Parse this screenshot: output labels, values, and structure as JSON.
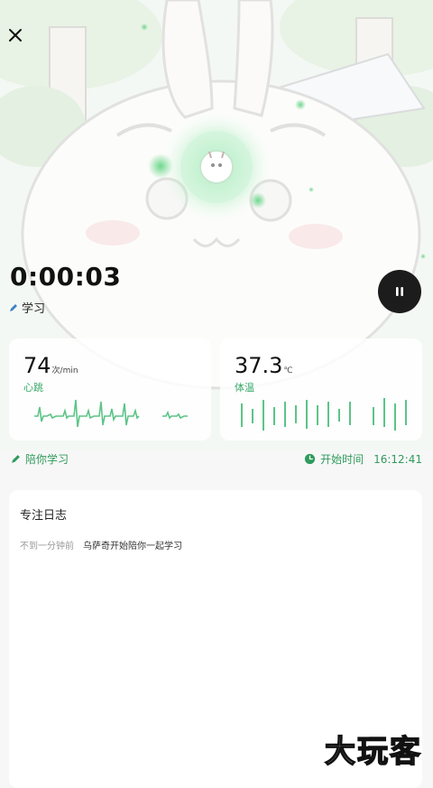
{
  "session": {
    "timer": "0:00:03",
    "activity": "学习"
  },
  "metrics": {
    "heart_rate": {
      "value": "74",
      "unit": "次/min",
      "label": "心跳"
    },
    "temperature": {
      "value": "37.3",
      "unit": "℃",
      "label": "体温"
    }
  },
  "companion": {
    "label": "陪你学习"
  },
  "start": {
    "label": "开始时间",
    "time": "16:12:41"
  },
  "log": {
    "title": "专注日志",
    "entries": [
      {
        "time": "不到一分钟前",
        "text": "乌萨奇开始陪你一起学习"
      }
    ]
  },
  "watermark": "大玩客",
  "colors": {
    "accent_green": "#2f9b5c",
    "pause_button": "#1c1c1c"
  },
  "icons": [
    "close-icon",
    "pen-icon",
    "pause-icon",
    "clock-icon"
  ]
}
